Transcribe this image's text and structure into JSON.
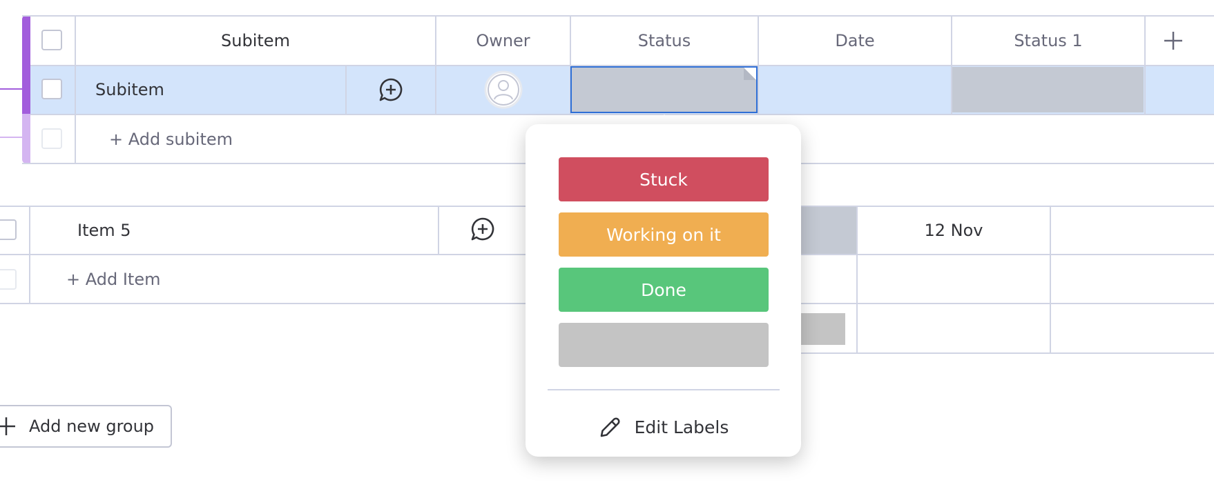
{
  "subitems_table": {
    "headers": {
      "subitem": "Subitem",
      "owner": "Owner",
      "status": "Status",
      "date": "Date",
      "status1": "Status 1",
      "add_column": "+"
    },
    "row": {
      "name": "Subitem"
    },
    "add_subitem": "+ Add subitem"
  },
  "items_table": {
    "row": {
      "name": "Item 5",
      "date": "12 Nov"
    },
    "add_item": "+ Add Item"
  },
  "add_group": {
    "label": "Add new group"
  },
  "status_popover": {
    "labels": [
      {
        "text": "Stuck",
        "color": "#d04e5f"
      },
      {
        "text": "Working on it",
        "color": "#f0ae51"
      },
      {
        "text": "Done",
        "color": "#58c67b"
      },
      {
        "text": "",
        "color": "#c4c4c4"
      }
    ],
    "edit_labels": "Edit Labels"
  },
  "colors": {
    "group_accent": "#a25ddc",
    "group_accent_light": "#d4b5f1",
    "selected_row": "#d3e4fb",
    "empty_status": "#c4c9d3",
    "focus_border": "#2f6fd6"
  }
}
